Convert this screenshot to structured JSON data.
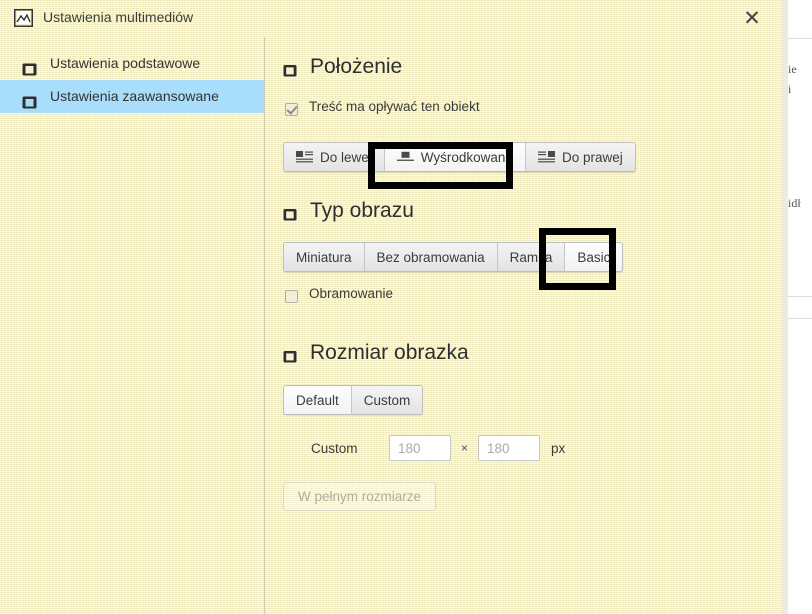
{
  "window": {
    "title": "Ustawienia multimediów",
    "title_icon": "image-icon",
    "close_label": "✕"
  },
  "sidebar": {
    "items": [
      {
        "label": "Ustawienia podstawowe",
        "icon": "panel-icon",
        "active": false
      },
      {
        "label": "Ustawienia zaawansowane",
        "icon": "panel-icon",
        "active": true
      }
    ]
  },
  "sections": {
    "position": {
      "title": "Położenie",
      "icon": "panel-icon",
      "wrap_checkbox": {
        "label": "Treść ma opływać ten obiekt",
        "checked": true
      },
      "align_buttons": [
        {
          "label": "Do lewej",
          "icon": "align-left-icon",
          "selected": false
        },
        {
          "label": "Wyśrodkowane",
          "icon": "align-center-icon",
          "selected": true
        },
        {
          "label": "Do prawej",
          "icon": "align-right-icon",
          "selected": false
        }
      ]
    },
    "image_type": {
      "title": "Typ obrazu",
      "icon": "panel-icon",
      "type_buttons": [
        {
          "label": "Miniatura",
          "selected": false
        },
        {
          "label": "Bez obramowania",
          "selected": false
        },
        {
          "label": "Ramka",
          "selected": false
        },
        {
          "label": "Basic",
          "selected": true
        }
      ],
      "border_checkbox": {
        "label": "Obramowanie",
        "checked": false
      }
    },
    "image_size": {
      "title": "Rozmiar obrazka",
      "icon": "panel-icon",
      "mode_buttons": [
        {
          "label": "Default",
          "selected": true
        },
        {
          "label": "Custom",
          "selected": false
        }
      ],
      "custom_label": "Custom",
      "width_value": "",
      "width_placeholder": "180",
      "separator": "×",
      "height_value": "",
      "height_placeholder": "180",
      "unit": "px",
      "fullsize_label": "W pełnym rozmiarze"
    }
  },
  "background_page": {
    "line1": "ie",
    "line2": "i",
    "line3": "idł"
  },
  "colors": {
    "dialog_bg": "#f7f3cf",
    "sidebar_active": "#a8ddfc",
    "highlight_border": "#000000",
    "text": "#333333"
  }
}
